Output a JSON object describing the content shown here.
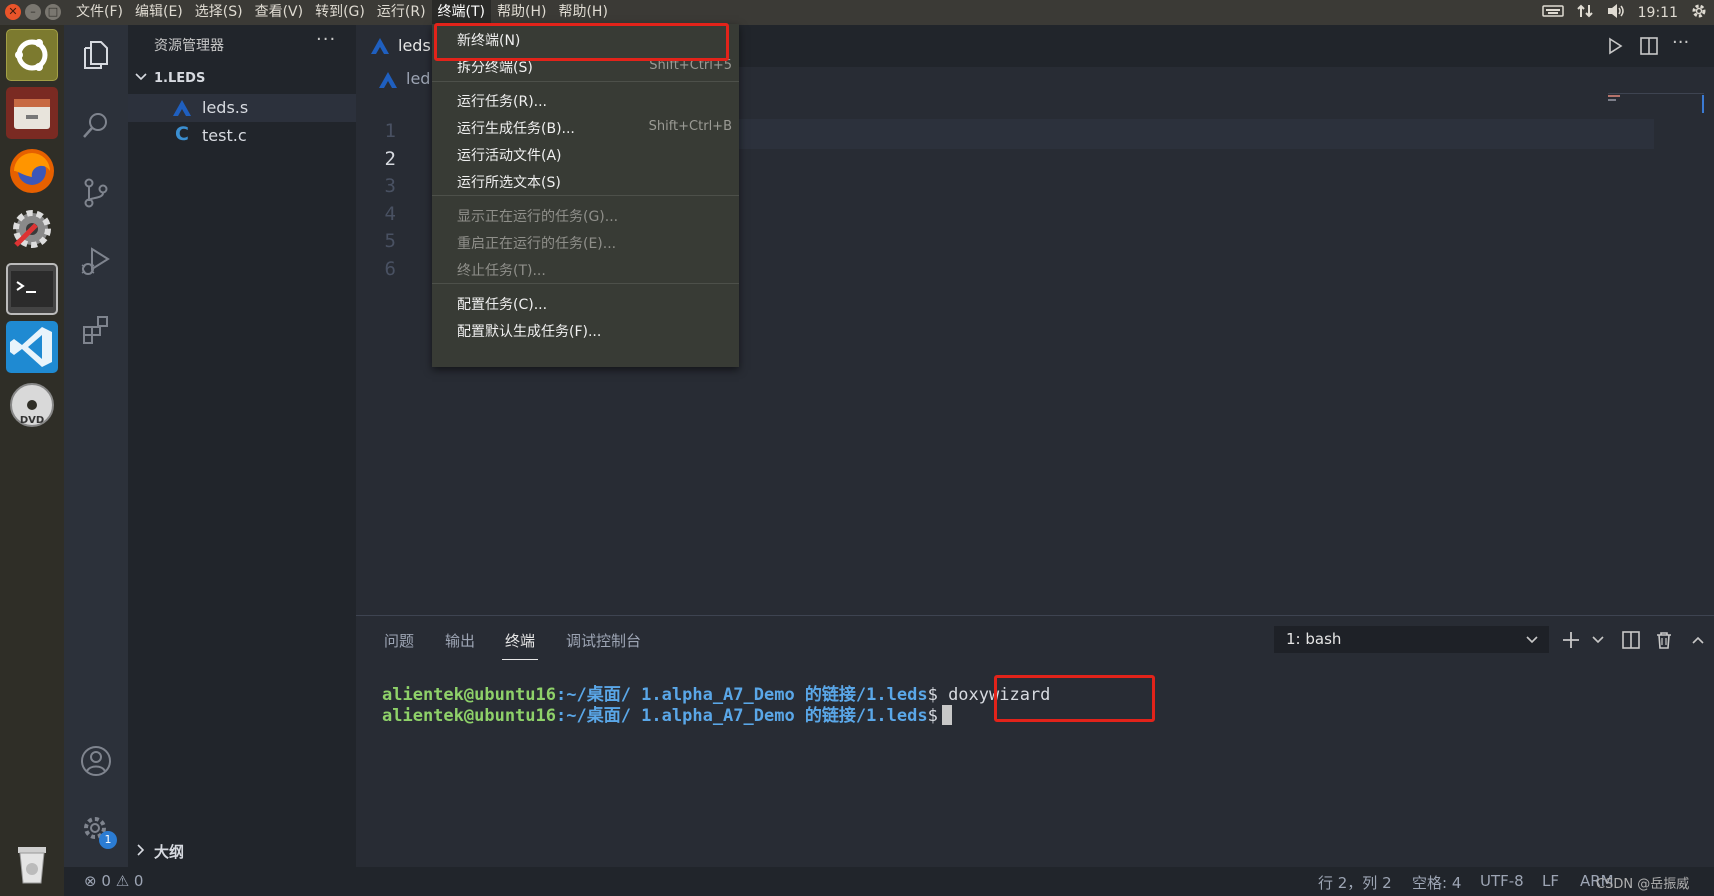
{
  "menubar": {
    "items": [
      "文件(F)",
      "编辑(E)",
      "选择(S)",
      "查看(V)",
      "转到(G)",
      "运行(R)",
      "终端(T)",
      "帮助(H)",
      "帮助(H)"
    ],
    "active_index": 6
  },
  "tray": {
    "time": "19:11"
  },
  "launcher": {
    "apps": [
      "ubuntu-dash-icon",
      "files-icon",
      "firefox-icon",
      "system-settings-icon",
      "terminal-icon",
      "vscode-icon",
      "dvd-icon",
      "trash-icon"
    ]
  },
  "activity_bar": {
    "items": [
      "explorer-icon",
      "search-icon",
      "source-control-icon",
      "run-debug-icon",
      "extensions-icon"
    ],
    "bottom": [
      "account-icon",
      "settings-icon"
    ],
    "settings_badge": "1"
  },
  "sidebar": {
    "title": "资源管理器",
    "more": "···",
    "folder": "1.LEDS",
    "files": [
      {
        "name": "leds.s",
        "icon": "assembly-file-icon",
        "selected": true
      },
      {
        "name": "test.c",
        "icon": "c-file-icon",
        "selected": false
      }
    ],
    "outline": "大纲"
  },
  "editor": {
    "tab_label": "leds.",
    "breadcrumb": "led",
    "line_numbers": [
      "1",
      "2",
      "3",
      "4",
      "5",
      "6"
    ],
    "current_line": 2
  },
  "terminal_menu": {
    "items": [
      {
        "label": "新终端(N)",
        "shortcut": "",
        "disabled": false
      },
      {
        "label": "拆分终端(S)",
        "shortcut": "Shift+Ctrl+5",
        "disabled": false
      },
      {
        "label": "运行任务(R)...",
        "shortcut": "",
        "disabled": false
      },
      {
        "label": "运行生成任务(B)...",
        "shortcut": "Shift+Ctrl+B",
        "disabled": false
      },
      {
        "label": "运行活动文件(A)",
        "shortcut": "",
        "disabled": false
      },
      {
        "label": "运行所选文本(S)",
        "shortcut": "",
        "disabled": false
      },
      {
        "label": "显示正在运行的任务(G)...",
        "shortcut": "",
        "disabled": true
      },
      {
        "label": "重启正在运行的任务(E)...",
        "shortcut": "",
        "disabled": true
      },
      {
        "label": "终止任务(T)...",
        "shortcut": "",
        "disabled": true
      },
      {
        "label": "配置任务(C)...",
        "shortcut": "",
        "disabled": false
      },
      {
        "label": "配置默认生成任务(F)...",
        "shortcut": "",
        "disabled": false
      }
    ]
  },
  "panel": {
    "tabs": [
      "问题",
      "输出",
      "终端",
      "调试控制台"
    ],
    "active_tab": 2,
    "terminal_select": "1: bash",
    "lines": [
      {
        "user": "alientek@ubuntu16",
        "path": ":~/桌面/ 1.alpha_A7_Demo 的链接/1.leds",
        "prompt": "$",
        "command": " doxywizard"
      },
      {
        "user": "alientek@ubuntu16",
        "path": ":~/桌面/ 1.alpha_A7_Demo 的链接/1.leds",
        "prompt": "$",
        "command": ""
      }
    ]
  },
  "statusbar": {
    "errors": "0",
    "warnings": "0",
    "position": "行 2，列 2",
    "spaces": "空格: 4",
    "encoding": "UTF-8",
    "eol": "LF",
    "language": "ARM",
    "watermark": "CSDN @岳振威"
  },
  "colors": {
    "highlight_box": "#e2231a",
    "terminal_user": "#8ed169",
    "terminal_path": "#5aa7e8"
  }
}
